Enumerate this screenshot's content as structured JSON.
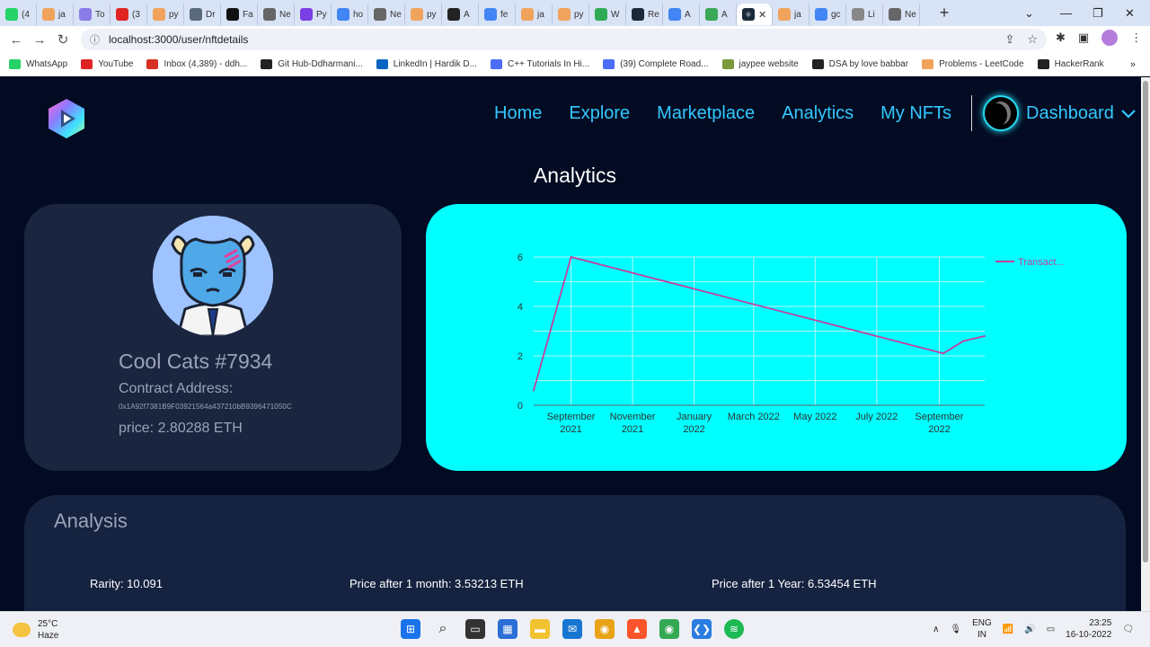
{
  "browser": {
    "tabs": [
      {
        "label": "(4",
        "color": "#25d366"
      },
      {
        "label": "ja",
        "color": "#f0a35a"
      },
      {
        "label": "To",
        "color": "#8a7be8"
      },
      {
        "label": "(3",
        "color": "#e02424"
      },
      {
        "label": "py",
        "color": "#f0a35a"
      },
      {
        "label": "Dr",
        "color": "#5a6a7a"
      },
      {
        "label": "Fa",
        "color": "#111111"
      },
      {
        "label": "Ne",
        "color": "#666666"
      },
      {
        "label": "Py",
        "color": "#7b3fe4"
      },
      {
        "label": "ho",
        "color": "#4285f4"
      },
      {
        "label": "Ne",
        "color": "#666666"
      },
      {
        "label": "py",
        "color": "#f0a35a"
      },
      {
        "label": "A",
        "color": "#222222"
      },
      {
        "label": "fe",
        "color": "#4285f4"
      },
      {
        "label": "ja",
        "color": "#f0a35a"
      },
      {
        "label": "py",
        "color": "#f0a35a"
      },
      {
        "label": "W",
        "color": "#2eaa55"
      },
      {
        "label": "Re",
        "color": "#1b2a3a"
      },
      {
        "label": "A",
        "color": "#4285f4"
      },
      {
        "label": "A",
        "color": "#3aa757"
      }
    ],
    "active_tab_label": "",
    "tabs_after": [
      {
        "label": "ja",
        "color": "#f0a35a"
      },
      {
        "label": "gc",
        "color": "#4285f4"
      },
      {
        "label": "Li",
        "color": "#888888"
      },
      {
        "label": "Ne",
        "color": "#666666"
      }
    ],
    "url": "localhost:3000/user/nftdetails",
    "bookmarks": [
      {
        "label": "WhatsApp",
        "color": "#25d366"
      },
      {
        "label": "YouTube",
        "color": "#e02424"
      },
      {
        "label": "Inbox (4,389) - ddh...",
        "color": "#d93025"
      },
      {
        "label": "Git Hub-Ddharmani...",
        "color": "#222222"
      },
      {
        "label": "LinkedIn | Hardik D...",
        "color": "#0a66c2"
      },
      {
        "label": "C++ Tutorials In Hi...",
        "color": "#4a6cf7"
      },
      {
        "label": "(39) Complete Road...",
        "color": "#4a6cf7"
      },
      {
        "label": "jaypee website",
        "color": "#7a9a3a"
      },
      {
        "label": "DSA by love babbar",
        "color": "#222222"
      },
      {
        "label": "Problems - LeetCode",
        "color": "#f0a35a"
      },
      {
        "label": "HackerRank",
        "color": "#222222"
      }
    ]
  },
  "nav": {
    "links": [
      "Home",
      "Explore",
      "Marketplace",
      "Analytics",
      "My NFTs"
    ],
    "dashboard": "Dashboard"
  },
  "page": {
    "section_title": "Analytics",
    "nft": {
      "name": "Cool Cats #7934",
      "contract_label": "Contract Address:",
      "contract_address": "0x1A92f7381B9F03921564a437210bB9396471050C",
      "price": "price: 2.80288 ETH"
    },
    "analysis": {
      "title": "Analysis",
      "rarity": "Rarity: 10.091",
      "price_1m": "Price after 1 month: 3.53213 ETH",
      "price_1y": "Price after 1 Year: 6.53454 ETH"
    }
  },
  "chart_data": {
    "type": "line",
    "series": [
      {
        "name": "Transact...",
        "color": "#c2409e",
        "points": [
          {
            "x": "2021-07-26",
            "y": 0.6
          },
          {
            "x": "2021-09-01",
            "y": 6.0
          },
          {
            "x": "2022-09-05",
            "y": 2.1
          },
          {
            "x": "2022-09-25",
            "y": 2.6
          },
          {
            "x": "2022-10-16",
            "y": 2.8
          }
        ]
      }
    ],
    "ylim": [
      0,
      6
    ],
    "yticks": [
      "0",
      "2",
      "4",
      "6"
    ],
    "xticks": [
      [
        "September",
        "2021"
      ],
      [
        "November",
        "2021"
      ],
      [
        "January",
        "2022"
      ],
      [
        "March 2022",
        ""
      ],
      [
        "May 2022",
        ""
      ],
      [
        "July 2022",
        ""
      ],
      [
        "September",
        "2022"
      ]
    ],
    "grid": true,
    "legend": "top-right"
  },
  "taskbar": {
    "temp": "25°C",
    "weather": "Haze",
    "lang1": "ENG",
    "lang2": "IN",
    "time": "23:25",
    "date": "16-10-2022"
  }
}
